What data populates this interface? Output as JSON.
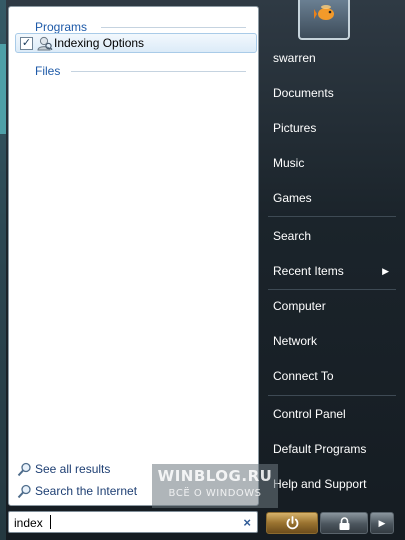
{
  "results": {
    "programs_header": "Programs",
    "files_header": "Files",
    "items": [
      {
        "label": "Indexing Options",
        "checked": true
      }
    ],
    "see_all_label": "See all results",
    "search_internet_label": "Search the Internet"
  },
  "search": {
    "value": "index",
    "clear_icon": "×"
  },
  "right_pane": {
    "user_name": "swarren",
    "items": [
      {
        "label": "Documents"
      },
      {
        "label": "Pictures"
      },
      {
        "label": "Music"
      },
      {
        "label": "Games"
      },
      {
        "label": "Search"
      },
      {
        "label": "Recent Items",
        "submenu_arrow": "▶"
      },
      {
        "label": "Computer"
      },
      {
        "label": "Network"
      },
      {
        "label": "Connect To"
      },
      {
        "label": "Control Panel"
      },
      {
        "label": "Default Programs"
      },
      {
        "label": "Help and Support"
      }
    ]
  },
  "power": {
    "arrow_glyph": "▶"
  },
  "watermark": {
    "title": "WINBLOG.RU",
    "subtitle": "ВСЁ О WINDOWS"
  },
  "colors": {
    "accent": "#1e5aa8",
    "power": "#b08a42"
  }
}
